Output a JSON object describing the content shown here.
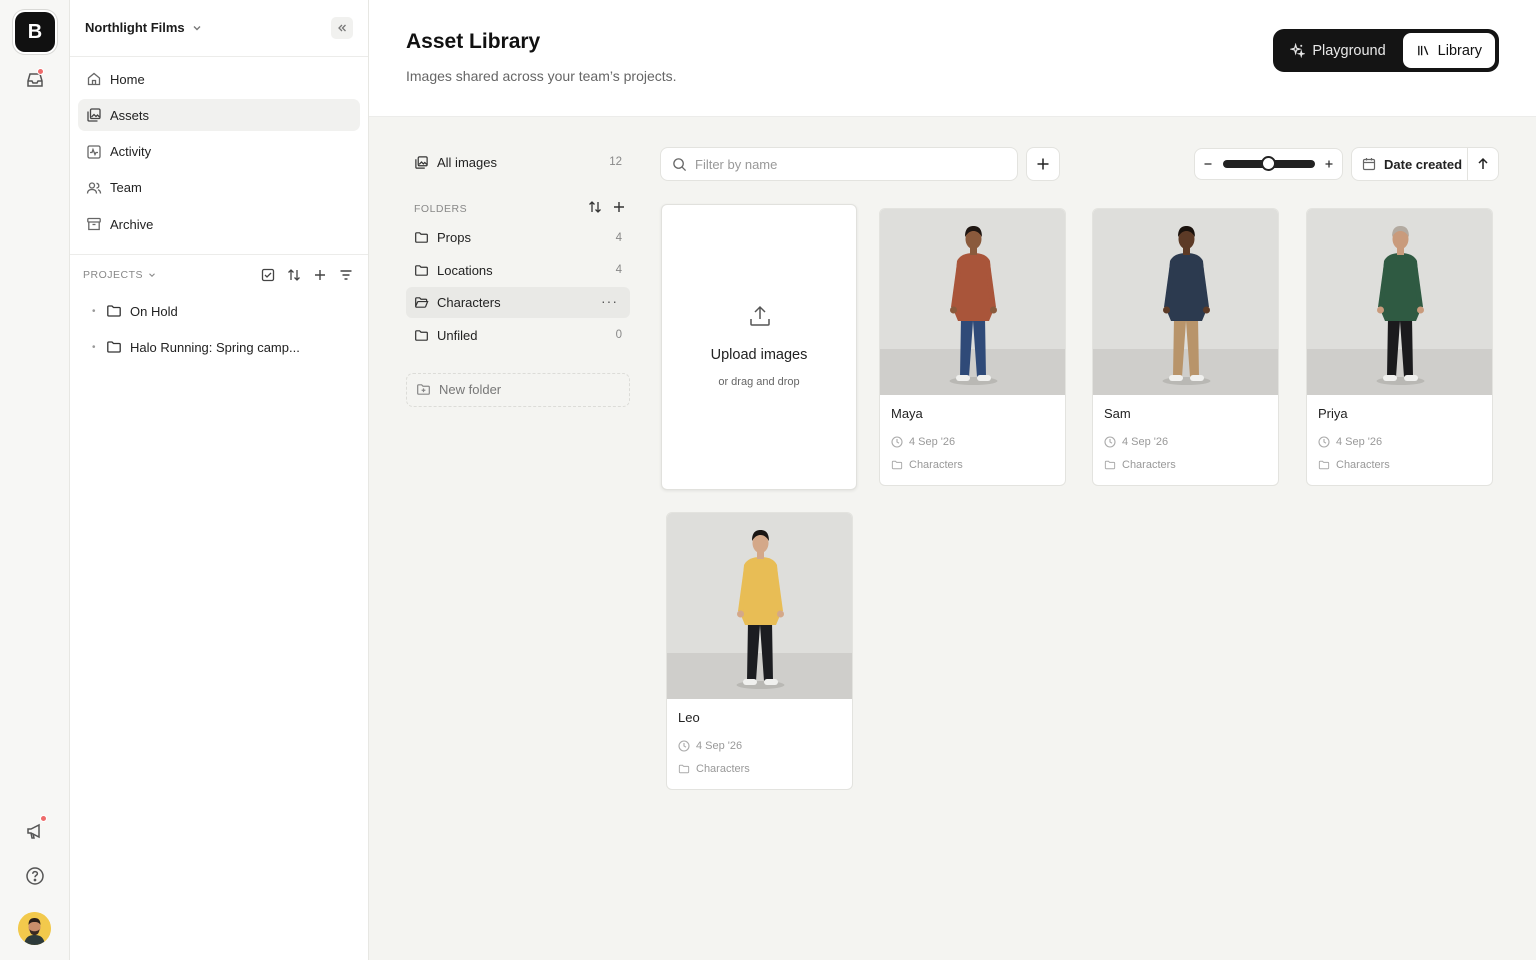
{
  "app": {
    "logo_letter": "B"
  },
  "workspace": {
    "name": "Northlight Films"
  },
  "nav": {
    "items": [
      {
        "label": "Home",
        "icon": "home-icon"
      },
      {
        "label": "Assets",
        "icon": "assets-icon",
        "active": true
      },
      {
        "label": "Activity",
        "icon": "activity-icon"
      },
      {
        "label": "Team",
        "icon": "team-icon"
      },
      {
        "label": "Archive",
        "icon": "archive-icon"
      }
    ]
  },
  "projects": {
    "label": "PROJECTS",
    "items": [
      {
        "label": "On Hold"
      },
      {
        "label": "Halo Running: Spring camp..."
      }
    ]
  },
  "header": {
    "title": "Asset Library",
    "subtitle": "Images shared across your team’s projects.",
    "modes": [
      {
        "label": "Playground",
        "icon": "sparkle-icon"
      },
      {
        "label": "Library",
        "icon": "library-icon",
        "active": true
      }
    ]
  },
  "folders": {
    "all_label": "All images",
    "all_count": "12",
    "section_label": "FOLDERS",
    "items": [
      {
        "label": "Props",
        "count": "4"
      },
      {
        "label": "Locations",
        "count": "4"
      },
      {
        "label": "Characters",
        "count": "",
        "active": true
      },
      {
        "label": "Unfiled",
        "count": "0"
      }
    ],
    "new_folder_label": "New folder"
  },
  "toolbar": {
    "search_placeholder": "Filter by name",
    "zoom_level": 0.5,
    "sort_label": "Date created"
  },
  "upload": {
    "title": "Upload images",
    "subtitle": "or drag and drop"
  },
  "assets": [
    {
      "name": "Maya",
      "date": "4 Sep '26",
      "folder": "Characters",
      "jacket": "#a9553a",
      "pants": "#2f4a78",
      "skin": "#8a5a3c",
      "hair": "#1f1612"
    },
    {
      "name": "Sam",
      "date": "4 Sep '26",
      "folder": "Characters",
      "jacket": "#2c3a4f",
      "pants": "#b8946a",
      "skin": "#5c3a26",
      "hair": "#1a120d"
    },
    {
      "name": "Priya",
      "date": "4 Sep '26",
      "folder": "Characters",
      "jacket": "#2f5a42",
      "pants": "#1b1b1d",
      "skin": "#c99b7c",
      "hair": "#b3aaa0"
    },
    {
      "name": "Leo",
      "date": "4 Sep '26",
      "folder": "Characters",
      "jacket": "#e8bd55",
      "pants": "#1c1d21",
      "skin": "#d4a889",
      "hair": "#1a1614"
    }
  ]
}
